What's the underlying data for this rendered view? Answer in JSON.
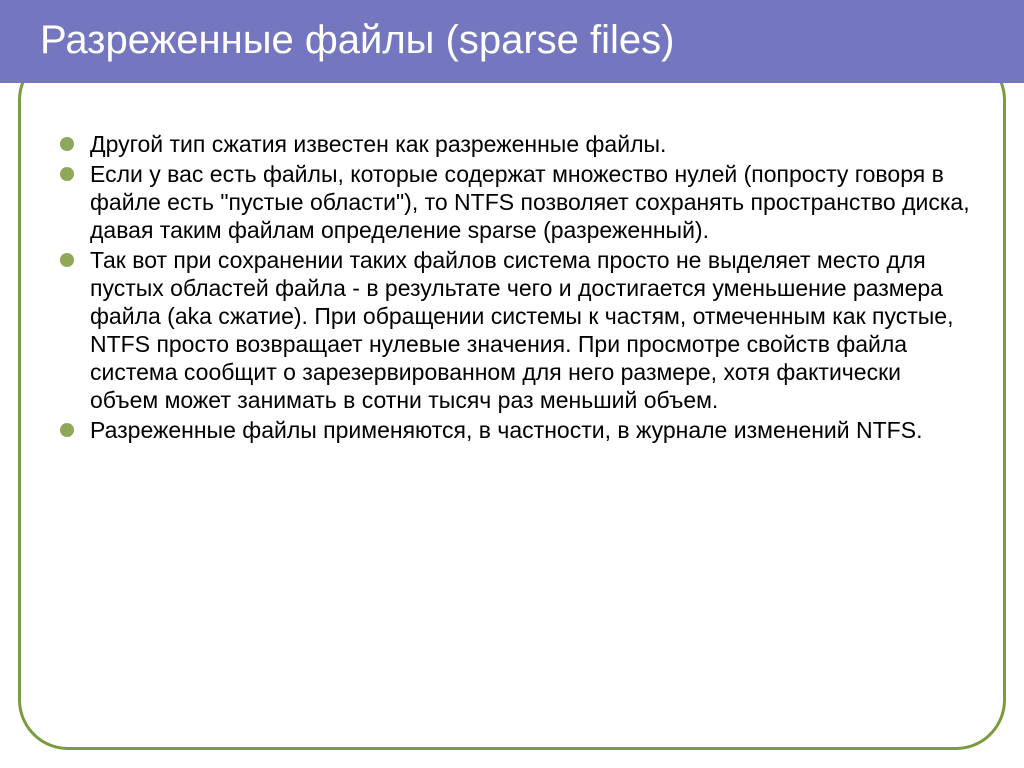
{
  "slide": {
    "title": "Разреженные файлы (sparse files)",
    "bullets": [
      "Другой тип сжатия известен как разреженные файлы.",
      "Если у вас есть файлы, которые содержат множество нулей (попросту говоря в файле есть \"пустые области\"), то NTFS позволяет сохранять пространство диска, давая таким файлам определение sparse (разреженный).",
      "Так вот при сохранении таких файлов система просто не выделяет место для пустых областей файла - в результате чего и достигается уменьшение размера файла (aka сжатие). При обращении системы к частям, отмеченным как пустые, NTFS просто возвращает нулевые значения. При просмотре свойств файла система сообщит о зарезервированном для него размере, хотя фактически объем может занимать в сотни тысяч раз меньший объем.",
      "Разреженные файлы применяются, в частности, в журнале изменений NTFS."
    ]
  },
  "colors": {
    "title_bg": "#7477c0",
    "border": "#7a9c3f",
    "bullet": "#8ea85a"
  }
}
